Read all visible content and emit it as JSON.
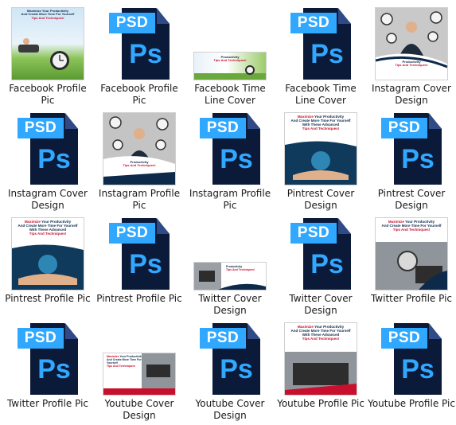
{
  "thumb_caption": {
    "line1_a": "Maximize",
    "line1_b": " Your ",
    "line1_c": "Productivity",
    "line2": "And Create More Time For Yourself",
    "line3": "With These Advanced",
    "line4": "Tips And Techniques!"
  },
  "psd_icon": {
    "tag": "PSD",
    "glyph": "Ps"
  },
  "files": [
    {
      "label": "Facebook Profile Pic",
      "kind": "image",
      "icon": "facebook-profile-thumbnail"
    },
    {
      "label": "Facebook Profile Pic",
      "kind": "psd",
      "icon": "psd-file-icon"
    },
    {
      "label": "Facebook Time Line Cover",
      "kind": "image",
      "icon": "facebook-timeline-thumbnail"
    },
    {
      "label": "Facebook Time Line Cover",
      "kind": "psd",
      "icon": "psd-file-icon"
    },
    {
      "label": "Instagram Cover Design",
      "kind": "image",
      "icon": "instagram-cover-thumbnail"
    },
    {
      "label": "Instagram Cover Design",
      "kind": "psd",
      "icon": "psd-file-icon"
    },
    {
      "label": "Instagram Profile Pic",
      "kind": "image",
      "icon": "instagram-profile-thumbnail"
    },
    {
      "label": "Instagram Profile Pic",
      "kind": "psd",
      "icon": "psd-file-icon"
    },
    {
      "label": "Pintrest Cover Design",
      "kind": "image",
      "icon": "pinterest-cover-thumbnail"
    },
    {
      "label": "Pintrest Cover Design",
      "kind": "psd",
      "icon": "psd-file-icon"
    },
    {
      "label": "Pintrest Profile Pic",
      "kind": "image",
      "icon": "pinterest-profile-thumbnail"
    },
    {
      "label": "Pintrest Profile Pic",
      "kind": "psd",
      "icon": "psd-file-icon"
    },
    {
      "label": "Twitter Cover Design",
      "kind": "image",
      "icon": "twitter-cover-thumbnail"
    },
    {
      "label": "Twitter Cover Design",
      "kind": "psd",
      "icon": "psd-file-icon"
    },
    {
      "label": "Twitter Profile Pic",
      "kind": "image",
      "icon": "twitter-profile-thumbnail"
    },
    {
      "label": "Twitter Profile Pic",
      "kind": "psd",
      "icon": "psd-file-icon"
    },
    {
      "label": "Youtube Cover Design",
      "kind": "image",
      "icon": "youtube-cover-thumbnail"
    },
    {
      "label": "Youtube Cover Design",
      "kind": "psd",
      "icon": "psd-file-icon"
    },
    {
      "label": "Youtube Profile Pic",
      "kind": "image",
      "icon": "youtube-profile-thumbnail"
    },
    {
      "label": "Youtube Profile Pic",
      "kind": "psd",
      "icon": "psd-file-icon"
    }
  ],
  "colors": {
    "psd_blue": "#31a8ff",
    "psd_navy": "#0c1a3a",
    "caption_red": "#c8102e",
    "caption_dark": "#0d2a4a"
  }
}
